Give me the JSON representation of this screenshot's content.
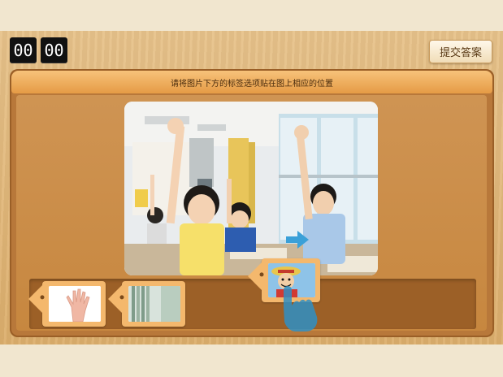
{
  "timer": {
    "minutes": "00",
    "seconds": "00"
  },
  "toolbar": {
    "submit_label": "提交答案"
  },
  "instruction": {
    "text": "请将图片下方的标签选项贴在图上相应的位置"
  },
  "main": {
    "image": {
      "name": "classroom-photo",
      "description_icon": "students-raising-hands"
    }
  },
  "tray": {
    "tags": [
      {
        "icon": "hand-icon"
      },
      {
        "icon": "curtain-icon"
      },
      {
        "icon": "cartoon-character-icon"
      }
    ]
  },
  "drag_hint": {
    "icon": "drag-hand-icon",
    "arrow": "arrow-right-icon"
  }
}
